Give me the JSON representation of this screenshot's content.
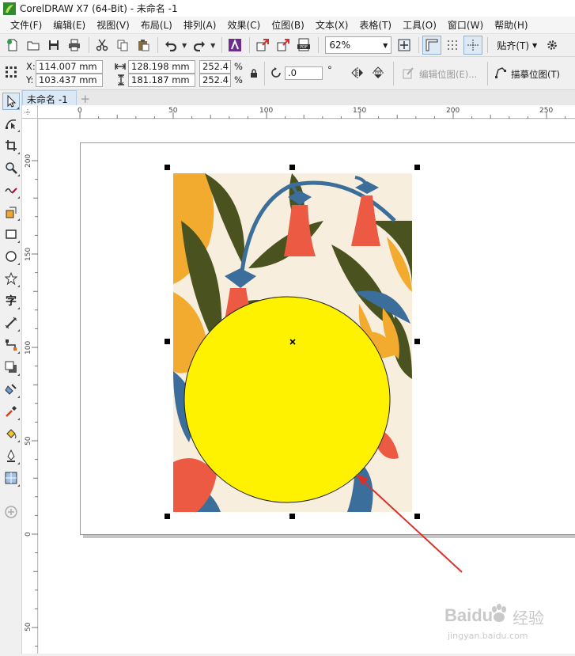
{
  "window": {
    "title": "CorelDRAW X7 (64-Bit) - 未命名 -1"
  },
  "menu": [
    {
      "label": "文件(F)"
    },
    {
      "label": "编辑(E)"
    },
    {
      "label": "视图(V)"
    },
    {
      "label": "布局(L)"
    },
    {
      "label": "排列(A)"
    },
    {
      "label": "效果(C)"
    },
    {
      "label": "位图(B)"
    },
    {
      "label": "文本(X)"
    },
    {
      "label": "表格(T)"
    },
    {
      "label": "工具(O)"
    },
    {
      "label": "窗口(W)"
    },
    {
      "label": "帮助(H)"
    }
  ],
  "toolbar": {
    "zoom_value": "62%",
    "snap_label": "贴齐(T)"
  },
  "property_bar": {
    "x_label": "X:",
    "x_value": "114.007 mm",
    "y_label": "Y:",
    "y_value": "103.437 mm",
    "width_value": "128.198 mm",
    "height_value": "181.187 mm",
    "scale_x": "252.4",
    "scale_y": "252.4",
    "percent": "%",
    "rotation_value": ".0",
    "degree_symbol": "°",
    "edit_bitmap_label": "编辑位图(E)...",
    "trace_bitmap_label": "描摹位图(T)"
  },
  "document": {
    "tab_label": "未命名 -1"
  },
  "ruler": {
    "h_ticks": [
      "0",
      "50",
      "100",
      "150",
      "200",
      "250"
    ],
    "v_ticks": [
      "200",
      "150",
      "100",
      "50",
      "0",
      "50"
    ]
  },
  "colors": {
    "circle_fill": "#fff200",
    "artwork_bg": "#f7eedd",
    "leaf_dark": "#4a5320",
    "stem_blue": "#3b6e9a",
    "bell_red": "#ec5a44",
    "petal_orange": "#f2ab2e",
    "arrow_red": "#d9312a"
  },
  "watermark": {
    "brand": "Baidu",
    "cn": "经验",
    "url": "jingyan.baidu.com"
  }
}
